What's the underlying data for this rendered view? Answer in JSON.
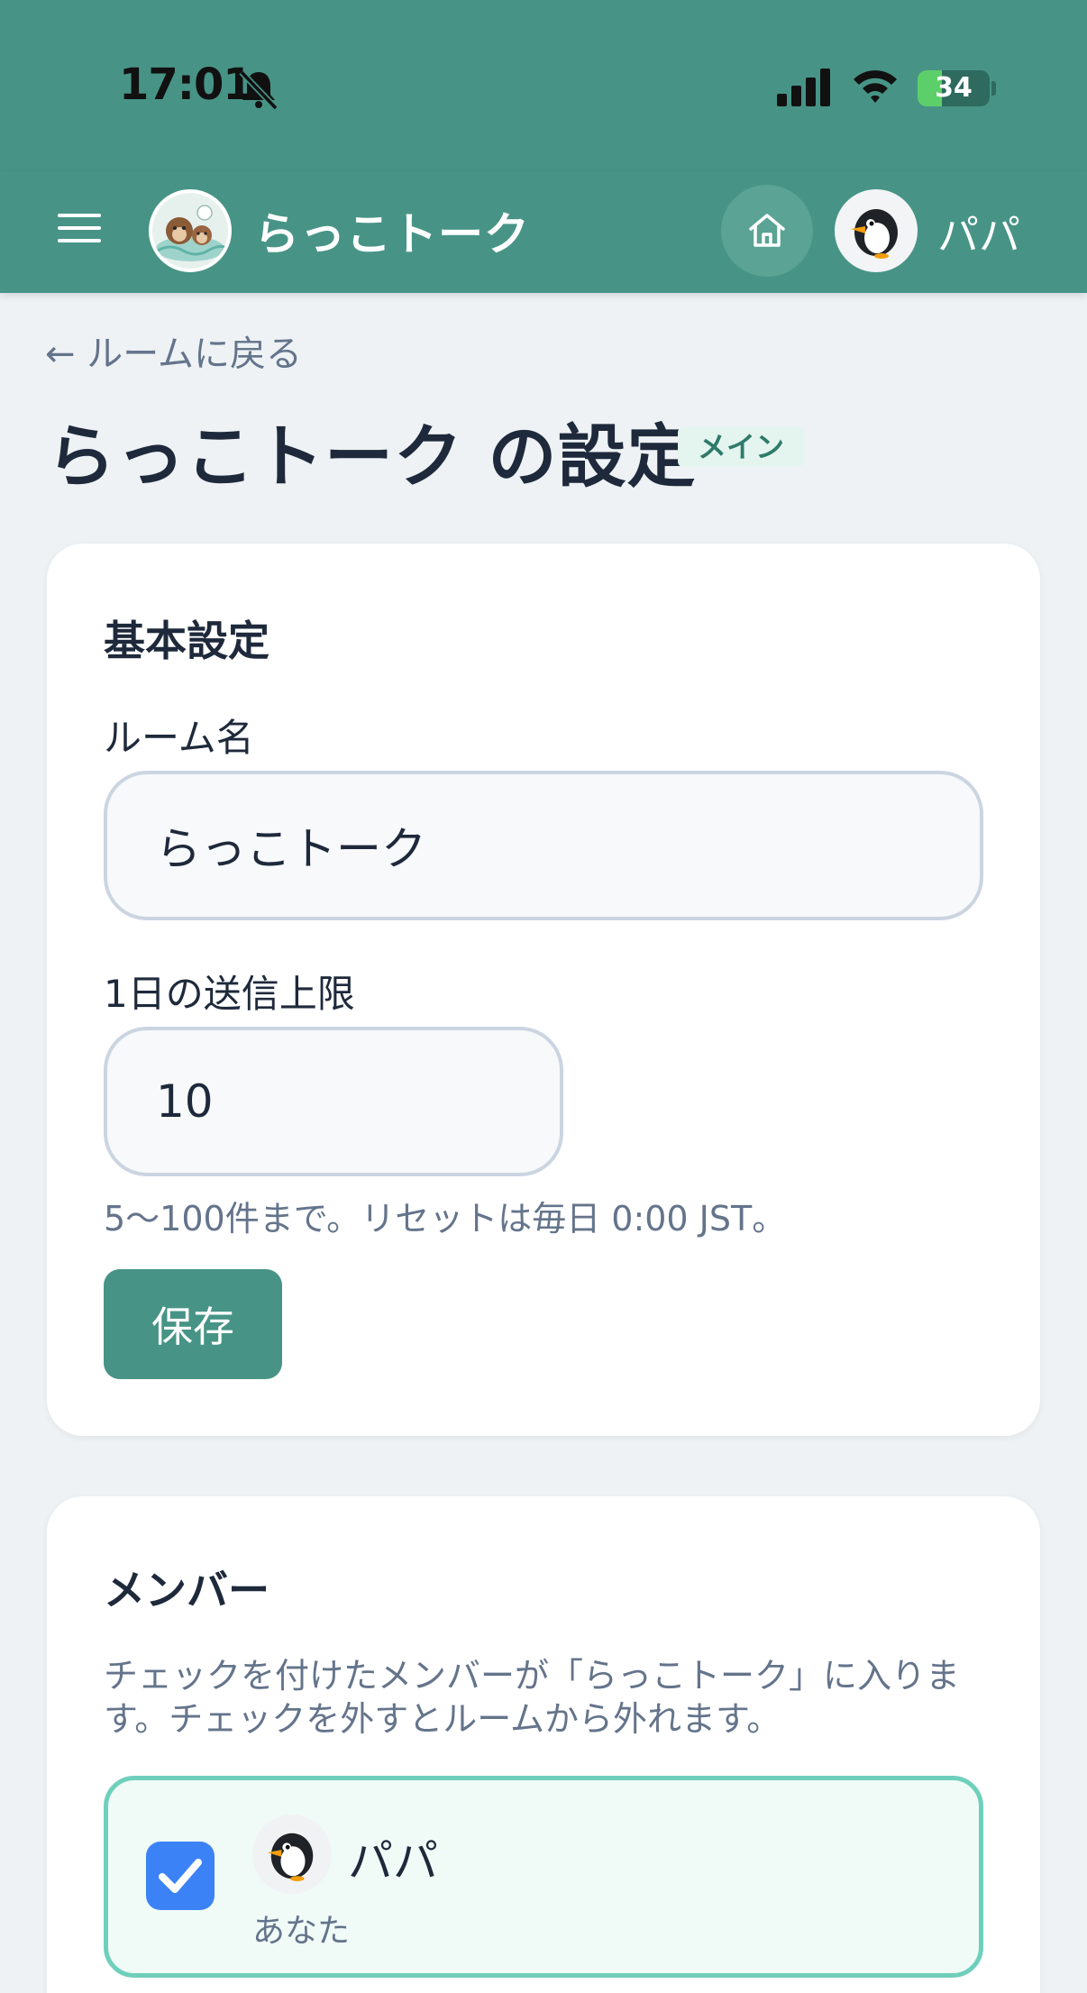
{
  "status_bar": {
    "time": "17:01",
    "battery": "34",
    "battery_level": 0.34
  },
  "header": {
    "title": "らっこトーク",
    "user_name": "パパ"
  },
  "nav": {
    "back_link": "← ルームに戻る"
  },
  "page": {
    "title": "らっこトーク の設定",
    "badge": "メイン"
  },
  "basic_settings": {
    "title": "基本設定",
    "room_name_label": "ルーム名",
    "room_name_value": "らっこトーク",
    "daily_limit_label": "1日の送信上限",
    "daily_limit_value": "10",
    "helper_text": "5〜100件まで。リセットは毎日 0:00 JST。",
    "save_label": "保存"
  },
  "members": {
    "title": "メンバー",
    "description": "チェックを付けたメンバーが「らっこトーク」に入ります。チェックを外すとルームから外れます。",
    "items": [
      {
        "name": "パパ",
        "subtitle": "あなた",
        "checked": true
      }
    ]
  },
  "colors": {
    "header": "#479486",
    "accent": "#479486",
    "checkbox": "#3b82f6",
    "selected_border": "#6fcfbb"
  }
}
